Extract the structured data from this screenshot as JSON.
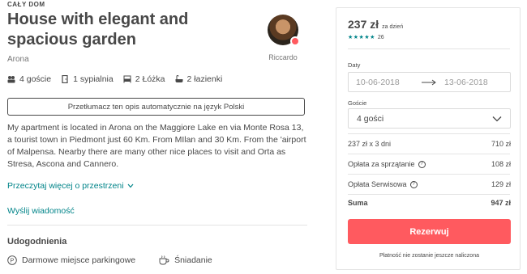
{
  "listing": {
    "kicker": "CAŁY DOM",
    "title": "House with elegant and spacious garden",
    "location": "Arona",
    "host_name": "Riccardo",
    "facts": {
      "guests": "4 goście",
      "bedrooms": "1 sypialnia",
      "beds": "2 Łóżka",
      "baths": "2 łazienki"
    },
    "translate_label": "Przetłumacz ten opis automatycznie na język Polski",
    "description": "My apartment is located in Arona on the Maggiore Lake en via Monte Rosa 13, a tourist town in Piedmont just 60 Km. From MIlan and 30 Km. From the 'airport of Malpensa. Nearby there are many other nice places to visit and Orta as Stresa, Ascona and Cannero.",
    "read_more": "Przeczytaj więcej o przestrzeni",
    "send_message": "Wyślij wiadomość",
    "amenities_title": "Udogodnienia",
    "amenities": [
      "Darmowe miejsce parkingowe",
      "Śniadanie"
    ]
  },
  "booking": {
    "price": "237 zł",
    "price_unit": "za dzień",
    "stars": "★★★★★",
    "review_count": "26",
    "dates_label": "Daty",
    "checkin": "10-06-2018",
    "checkout": "13-06-2018",
    "guests_label": "Goście",
    "guests_value": "4 gości",
    "lines": [
      {
        "label": "237 zł x 3 dni",
        "amount": "710 zł"
      },
      {
        "label": "Opłata za sprzątanie",
        "amount": "108 zł"
      },
      {
        "label": "Opłata Serwisowa",
        "amount": "129 zł"
      }
    ],
    "total_label": "Suma",
    "total_amount": "947 zł",
    "reserve_label": "Rezerwuj",
    "note": "Płatność nie zostanie jeszcze naliczona"
  },
  "colors": {
    "accent": "#ff5a5f",
    "link": "#008489",
    "text": "#484848"
  }
}
